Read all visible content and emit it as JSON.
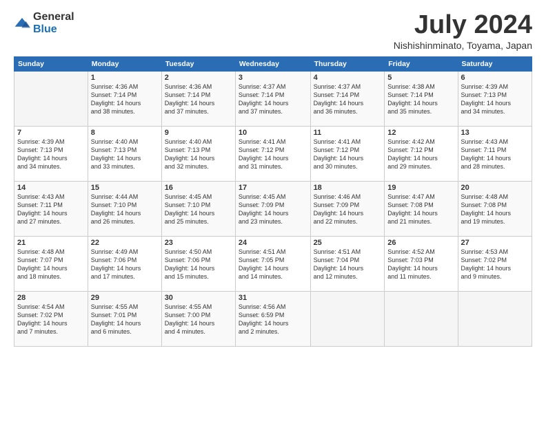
{
  "logo": {
    "general": "General",
    "blue": "Blue"
  },
  "title": "July 2024",
  "location": "Nishishinminato, Toyama, Japan",
  "days_header": [
    "Sunday",
    "Monday",
    "Tuesday",
    "Wednesday",
    "Thursday",
    "Friday",
    "Saturday"
  ],
  "weeks": [
    [
      {
        "day": "",
        "info": ""
      },
      {
        "day": "1",
        "info": "Sunrise: 4:36 AM\nSunset: 7:14 PM\nDaylight: 14 hours\nand 38 minutes."
      },
      {
        "day": "2",
        "info": "Sunrise: 4:36 AM\nSunset: 7:14 PM\nDaylight: 14 hours\nand 37 minutes."
      },
      {
        "day": "3",
        "info": "Sunrise: 4:37 AM\nSunset: 7:14 PM\nDaylight: 14 hours\nand 37 minutes."
      },
      {
        "day": "4",
        "info": "Sunrise: 4:37 AM\nSunset: 7:14 PM\nDaylight: 14 hours\nand 36 minutes."
      },
      {
        "day": "5",
        "info": "Sunrise: 4:38 AM\nSunset: 7:14 PM\nDaylight: 14 hours\nand 35 minutes."
      },
      {
        "day": "6",
        "info": "Sunrise: 4:39 AM\nSunset: 7:13 PM\nDaylight: 14 hours\nand 34 minutes."
      }
    ],
    [
      {
        "day": "7",
        "info": "Sunrise: 4:39 AM\nSunset: 7:13 PM\nDaylight: 14 hours\nand 34 minutes."
      },
      {
        "day": "8",
        "info": "Sunrise: 4:40 AM\nSunset: 7:13 PM\nDaylight: 14 hours\nand 33 minutes."
      },
      {
        "day": "9",
        "info": "Sunrise: 4:40 AM\nSunset: 7:13 PM\nDaylight: 14 hours\nand 32 minutes."
      },
      {
        "day": "10",
        "info": "Sunrise: 4:41 AM\nSunset: 7:12 PM\nDaylight: 14 hours\nand 31 minutes."
      },
      {
        "day": "11",
        "info": "Sunrise: 4:41 AM\nSunset: 7:12 PM\nDaylight: 14 hours\nand 30 minutes."
      },
      {
        "day": "12",
        "info": "Sunrise: 4:42 AM\nSunset: 7:12 PM\nDaylight: 14 hours\nand 29 minutes."
      },
      {
        "day": "13",
        "info": "Sunrise: 4:43 AM\nSunset: 7:11 PM\nDaylight: 14 hours\nand 28 minutes."
      }
    ],
    [
      {
        "day": "14",
        "info": "Sunrise: 4:43 AM\nSunset: 7:11 PM\nDaylight: 14 hours\nand 27 minutes."
      },
      {
        "day": "15",
        "info": "Sunrise: 4:44 AM\nSunset: 7:10 PM\nDaylight: 14 hours\nand 26 minutes."
      },
      {
        "day": "16",
        "info": "Sunrise: 4:45 AM\nSunset: 7:10 PM\nDaylight: 14 hours\nand 25 minutes."
      },
      {
        "day": "17",
        "info": "Sunrise: 4:45 AM\nSunset: 7:09 PM\nDaylight: 14 hours\nand 23 minutes."
      },
      {
        "day": "18",
        "info": "Sunrise: 4:46 AM\nSunset: 7:09 PM\nDaylight: 14 hours\nand 22 minutes."
      },
      {
        "day": "19",
        "info": "Sunrise: 4:47 AM\nSunset: 7:08 PM\nDaylight: 14 hours\nand 21 minutes."
      },
      {
        "day": "20",
        "info": "Sunrise: 4:48 AM\nSunset: 7:08 PM\nDaylight: 14 hours\nand 19 minutes."
      }
    ],
    [
      {
        "day": "21",
        "info": "Sunrise: 4:48 AM\nSunset: 7:07 PM\nDaylight: 14 hours\nand 18 minutes."
      },
      {
        "day": "22",
        "info": "Sunrise: 4:49 AM\nSunset: 7:06 PM\nDaylight: 14 hours\nand 17 minutes."
      },
      {
        "day": "23",
        "info": "Sunrise: 4:50 AM\nSunset: 7:06 PM\nDaylight: 14 hours\nand 15 minutes."
      },
      {
        "day": "24",
        "info": "Sunrise: 4:51 AM\nSunset: 7:05 PM\nDaylight: 14 hours\nand 14 minutes."
      },
      {
        "day": "25",
        "info": "Sunrise: 4:51 AM\nSunset: 7:04 PM\nDaylight: 14 hours\nand 12 minutes."
      },
      {
        "day": "26",
        "info": "Sunrise: 4:52 AM\nSunset: 7:03 PM\nDaylight: 14 hours\nand 11 minutes."
      },
      {
        "day": "27",
        "info": "Sunrise: 4:53 AM\nSunset: 7:02 PM\nDaylight: 14 hours\nand 9 minutes."
      }
    ],
    [
      {
        "day": "28",
        "info": "Sunrise: 4:54 AM\nSunset: 7:02 PM\nDaylight: 14 hours\nand 7 minutes."
      },
      {
        "day": "29",
        "info": "Sunrise: 4:55 AM\nSunset: 7:01 PM\nDaylight: 14 hours\nand 6 minutes."
      },
      {
        "day": "30",
        "info": "Sunrise: 4:55 AM\nSunset: 7:00 PM\nDaylight: 14 hours\nand 4 minutes."
      },
      {
        "day": "31",
        "info": "Sunrise: 4:56 AM\nSunset: 6:59 PM\nDaylight: 14 hours\nand 2 minutes."
      },
      {
        "day": "",
        "info": ""
      },
      {
        "day": "",
        "info": ""
      },
      {
        "day": "",
        "info": ""
      }
    ]
  ]
}
